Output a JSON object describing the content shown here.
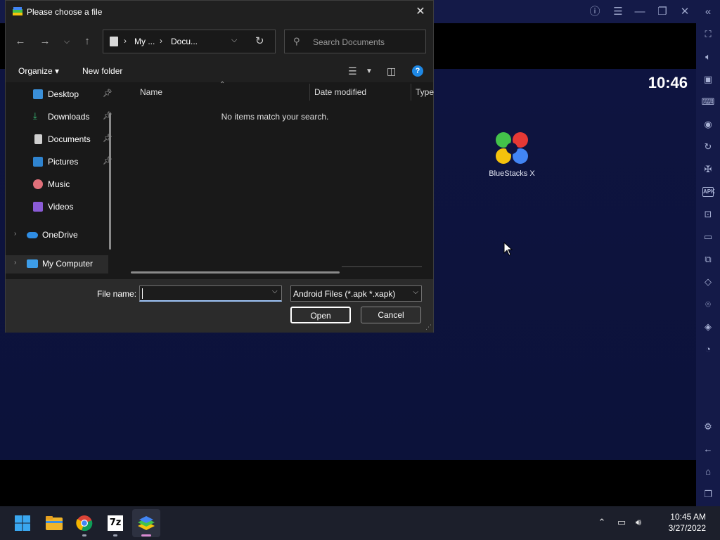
{
  "dialog": {
    "title": "Please choose a file",
    "address": {
      "crumb1": "My ...",
      "crumb2": "Docu..."
    },
    "search_placeholder": "Search Documents",
    "toolbar": {
      "organize": "Organize ▾",
      "new_folder": "New folder"
    },
    "nav_items": [
      {
        "label": "Desktop",
        "icon": "desktop-icon",
        "pinned": true
      },
      {
        "label": "Downloads",
        "icon": "downloads-icon",
        "pinned": true
      },
      {
        "label": "Documents",
        "icon": "documents-icon",
        "pinned": true
      },
      {
        "label": "Pictures",
        "icon": "pictures-icon",
        "pinned": true
      },
      {
        "label": "Music",
        "icon": "music-icon",
        "pinned": false
      },
      {
        "label": "Videos",
        "icon": "videos-icon",
        "pinned": false
      },
      {
        "label": "OneDrive",
        "icon": "onedrive-icon",
        "expandable": true
      },
      {
        "label": "My Computer",
        "icon": "computer-icon",
        "expandable": true,
        "selected": true
      }
    ],
    "columns": {
      "name": "Name",
      "date_modified": "Date modified",
      "type": "Type"
    },
    "empty_message": "No items match your search.",
    "file_name_label": "File name:",
    "file_name_value": "",
    "file_type": "Android Files (*.apk *.xapk)",
    "open_label": "Open",
    "cancel_label": "Cancel"
  },
  "bluestacks": {
    "clock": "10:46",
    "app_label": "BlueStacks X",
    "sidebar_icons": [
      "fullscreen-icon",
      "volume-icon",
      "media-icon",
      "keyboard-icon",
      "macro-icon",
      "rotate-icon",
      "gamepad-icon",
      "apk-icon",
      "screenshot-icon",
      "folder-icon",
      "multi-instance-icon",
      "eco-icon",
      "location-icon",
      "layers-icon",
      "performance-icon",
      "settings-icon",
      "back-icon",
      "home-icon",
      "recents-icon"
    ]
  },
  "taskbar": {
    "apps": [
      "start-icon",
      "file-explorer-icon",
      "chrome-icon",
      "7zip-icon",
      "bluestacks-icon"
    ],
    "zip_label": "7z",
    "time": "10:45 AM",
    "date": "3/27/2022"
  },
  "colors": {
    "accent": "#1e88e5",
    "dialog_bg": "#202020",
    "bs_bg": "#0b0f2e",
    "bs_bar": "#141a48"
  }
}
